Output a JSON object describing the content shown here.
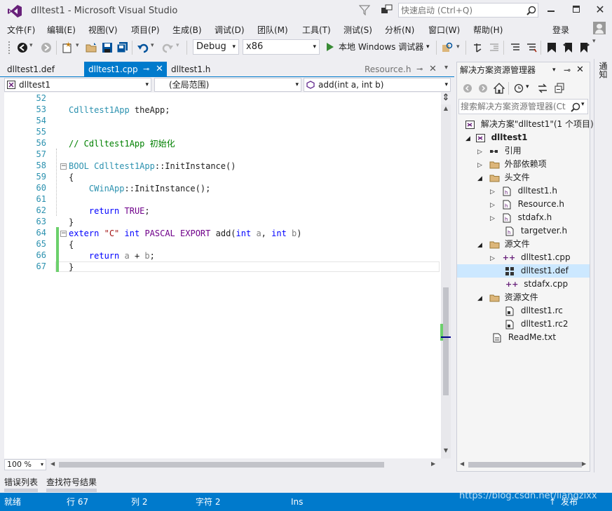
{
  "window": {
    "title": "dlltest1 - Microsoft Visual Studio",
    "quick_launch_placeholder": "快速启动 (Ctrl+Q)",
    "signin": "登录"
  },
  "menu": [
    "文件(F)",
    "编辑(E)",
    "视图(V)",
    "项目(P)",
    "生成(B)",
    "调试(D)",
    "团队(M)",
    "工具(T)",
    "测试(S)",
    "分析(N)",
    "窗口(W)",
    "帮助(H)"
  ],
  "toolbar": {
    "config": "Debug",
    "platform": "x86",
    "run_label": "本地 Windows 调试器"
  },
  "side_strip_label": "通知",
  "doc_tabs": [
    {
      "label": "dlltest1.def"
    },
    {
      "label": "dlltest1.cpp"
    },
    {
      "label": "dlltest1.h"
    },
    {
      "label": "Resource.h"
    }
  ],
  "nav": {
    "project": "dlltest1",
    "scope": "(全局范围)",
    "member": "add(int a, int b)"
  },
  "code": [
    {
      "n": "52",
      "t": ""
    },
    {
      "n": "53",
      "t": "Cdlltest1App theApp;"
    },
    {
      "n": "54",
      "t": ""
    },
    {
      "n": "55",
      "t": ""
    },
    {
      "n": "56",
      "t": "// Cdlltest1App 初始化"
    },
    {
      "n": "57",
      "t": ""
    },
    {
      "n": "58",
      "t": "BOOL Cdlltest1App::InitInstance()"
    },
    {
      "n": "59",
      "t": "{"
    },
    {
      "n": "60",
      "t": "    CWinApp::InitInstance();"
    },
    {
      "n": "61",
      "t": ""
    },
    {
      "n": "62",
      "t": "    return TRUE;"
    },
    {
      "n": "63",
      "t": "}"
    },
    {
      "n": "64",
      "t": "extern \"C\" int PASCAL EXPORT add(int a, int b)"
    },
    {
      "n": "65",
      "t": "{"
    },
    {
      "n": "66",
      "t": "    return a + b;"
    },
    {
      "n": "67",
      "t": "}"
    }
  ],
  "zoom": "100 %",
  "bottom_tabs": [
    "错误列表",
    "查找符号结果"
  ],
  "status": {
    "ready": "就绪",
    "line": "行 67",
    "col": "列 2",
    "char": "字符 2",
    "mode": "Ins",
    "publish": "发布",
    "watermark": "https://blog.csdn.net/liangzixx"
  },
  "solution_explorer": {
    "title": "解决方案资源管理器",
    "search_placeholder": "搜索解决方案资源管理器(Ct",
    "items": [
      {
        "label": "解决方案\"dlltest1\"(1 个项目)",
        "icon": "solution-icon"
      },
      {
        "label": "dlltest1",
        "icon": "project-icon"
      },
      {
        "label": "引用",
        "icon": "references-icon"
      },
      {
        "label": "外部依赖项",
        "icon": "folder-icon"
      },
      {
        "label": "头文件",
        "icon": "folder-icon"
      },
      {
        "label": "dlltest1.h",
        "icon": "header-file-icon"
      },
      {
        "label": "Resource.h",
        "icon": "header-file-icon"
      },
      {
        "label": "stdafx.h",
        "icon": "header-file-icon"
      },
      {
        "label": "targetver.h",
        "icon": "header-file-icon"
      },
      {
        "label": "源文件",
        "icon": "folder-icon"
      },
      {
        "label": "dlltest1.cpp",
        "icon": "cpp-file-icon"
      },
      {
        "label": "dlltest1.def",
        "icon": "def-file-icon"
      },
      {
        "label": "stdafx.cpp",
        "icon": "cpp-file-icon"
      },
      {
        "label": "资源文件",
        "icon": "folder-icon"
      },
      {
        "label": "dlltest1.rc",
        "icon": "rc-file-icon"
      },
      {
        "label": "dlltest1.rc2",
        "icon": "rc-file-icon"
      },
      {
        "label": "ReadMe.txt",
        "icon": "text-file-icon"
      }
    ]
  },
  "colors": {
    "accent": "#007acc",
    "keyword": "#0000ff",
    "type": "#2b91af",
    "comment": "#008000",
    "string": "#a31515",
    "macro": "#6f008a",
    "changed": "#6cd06c"
  }
}
